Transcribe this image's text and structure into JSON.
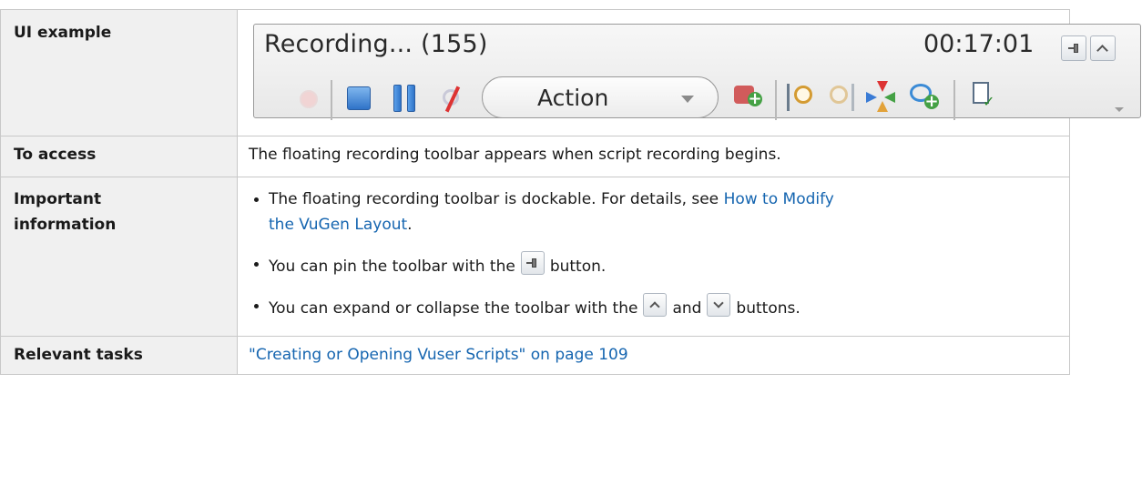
{
  "rows": {
    "ui_example": {
      "label": "UI example"
    },
    "to_access": {
      "label": "To access",
      "text": "The floating recording toolbar appears when script recording begins."
    },
    "important": {
      "label_line1": "Important",
      "label_line2": "information",
      "bullet1": {
        "text_before": "The floating recording toolbar is dockable. For details, see ",
        "link_line1": "How to Modify",
        "link_line2": "the VuGen Layout",
        "text_after": "."
      },
      "bullet2": {
        "text_before": "You can pin the toolbar with the",
        "text_after": "button."
      },
      "bullet3": {
        "text_before": "You can expand or collapse the toolbar with the",
        "text_mid": "and",
        "text_after": "buttons."
      }
    },
    "relevant": {
      "label": "Relevant tasks",
      "link": "\"Creating or Opening Vuser Scripts\" on page 109"
    }
  },
  "toolbar": {
    "title": "Recording... (155)",
    "timer": "00:17:01",
    "action_value": "Action"
  },
  "icons": {
    "pin": "pin-icon",
    "collapse": "chevron-up-icon",
    "expand": "chevron-down-icon",
    "record": "record-icon",
    "stop": "stop-icon",
    "pause": "pause-icon",
    "cancel": "cancel-recording-icon"
  },
  "colors": {
    "link": "#1565b0",
    "header_bg": "#f0f0f0"
  }
}
